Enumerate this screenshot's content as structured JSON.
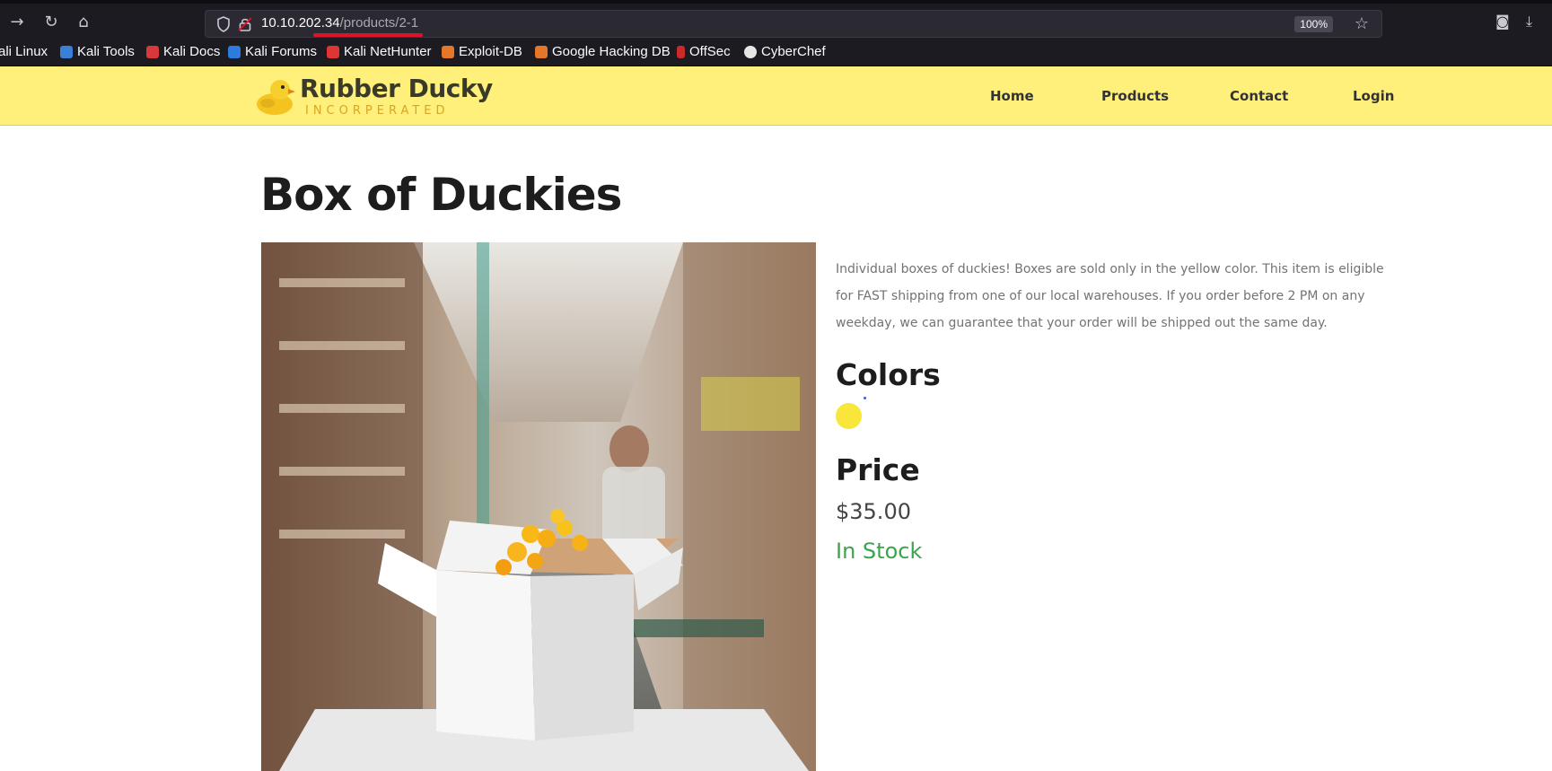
{
  "browser": {
    "url_host": "10.10.202.34",
    "url_path": "/products/2-1",
    "zoom": "100%"
  },
  "bookmarks": [
    {
      "label": "Kali Linux",
      "icon": "kali-icon",
      "color": "#3c7fd8"
    },
    {
      "label": "Kali Tools",
      "icon": "kali-tools-icon",
      "color": "#3c7fd8"
    },
    {
      "label": "Kali Docs",
      "icon": "kali-docs-icon",
      "color": "#d93838"
    },
    {
      "label": "Kali Forums",
      "icon": "kali-forums-icon",
      "color": "#2d7bdc"
    },
    {
      "label": "Kali NetHunter",
      "icon": "nethunter-icon",
      "color": "#e03535"
    },
    {
      "label": "Exploit-DB",
      "icon": "exploit-db-icon",
      "color": "#e5772a"
    },
    {
      "label": "Google Hacking DB",
      "icon": "ghdb-icon",
      "color": "#e5772a"
    },
    {
      "label": "OffSec",
      "icon": "offsec-icon",
      "color": "#c92a2a"
    },
    {
      "label": "CyberChef",
      "icon": "cyberchef-icon",
      "color": "#e6e6e6"
    }
  ],
  "site": {
    "brand_name": "Rubber Ducky",
    "brand_sub": "INCORPERATED",
    "nav": [
      "Home",
      "Products",
      "Contact",
      "Login"
    ],
    "header_color": "#fff07c"
  },
  "product": {
    "title": "Box of Duckies",
    "description": "Individual boxes of duckies! Boxes are sold only in the yellow color. This item is eligible for FAST shipping from one of our local warehouses. If you order before 2 PM on any weekday, we can guarantee that your order will be shipped out the same day.",
    "colors_heading": "Colors",
    "colors": [
      {
        "name": "yellow",
        "hex": "#f9e63a"
      }
    ],
    "price_heading": "Price",
    "price": "$35.00",
    "stock": "In Stock",
    "stock_color": "#3aa54a"
  }
}
